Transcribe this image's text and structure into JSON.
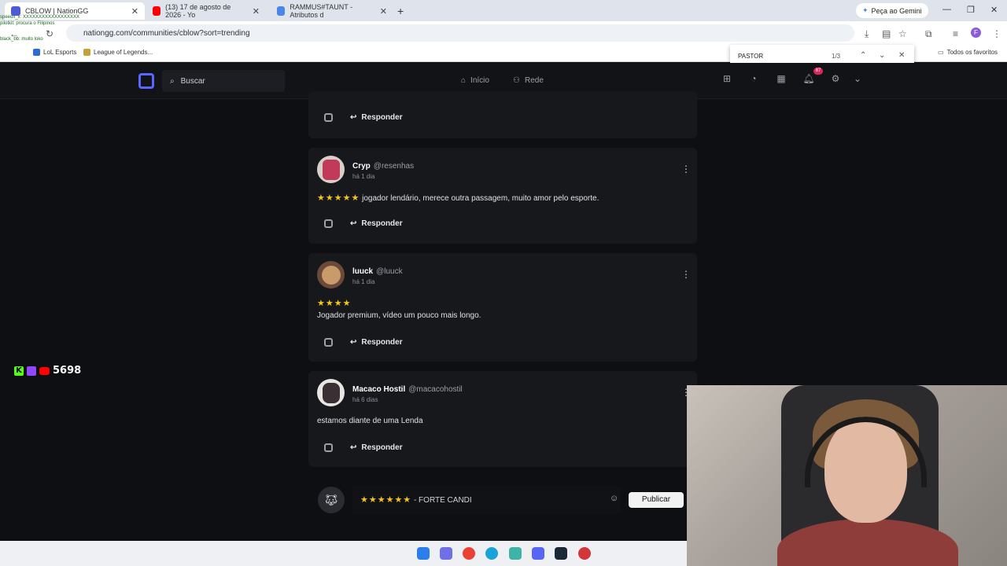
{
  "browser": {
    "tabs": [
      {
        "title": "CBLOW | NationGG",
        "active": true
      },
      {
        "title": "(13) 17 de agosto de 2026 - Yo",
        "active": false
      },
      {
        "title": "RAMMUS#TAUNT - Atributos d",
        "active": false
      }
    ],
    "new_tab": "+",
    "gemini": "Peça ao Gemini",
    "url": "nationgg.com/communities/cblow?sort=trending",
    "bookmarks": [
      "LoL Esports",
      "League of Legends..."
    ],
    "bookmarks_right": "Todos os favoritos",
    "find": {
      "query": "PASTOR",
      "count": "1/3"
    }
  },
  "overlay": {
    "chat_lines": [
      "speedx_x: XXXXXXXXXXXXXXXXXX",
      "pilotkit: procura o Filipinos",
      "black_bb: muito loko"
    ],
    "counter": "5698"
  },
  "app": {
    "search_placeholder": "Buscar",
    "nav": {
      "home": "Início",
      "network": "Rede"
    },
    "notif_count": "87"
  },
  "posts": [
    {
      "reply": "Responder"
    },
    {
      "name": "Cryp",
      "handle": "@resenhas",
      "time": "há 1 dia",
      "stars": "★★★★★",
      "text": "jogador lendário, merece outra passagem, muito amor pelo esporte.",
      "reply": "Responder"
    },
    {
      "name": "luuck",
      "handle": "@luuck",
      "time": "há 1 dia",
      "stars": "★★★★",
      "text": "Jogador premium, vídeo um pouco mais longo.",
      "reply": "Responder"
    },
    {
      "name": "Macaco Hostil",
      "handle": "@macacohostil",
      "time": "há 6 dias",
      "text": "estamos diante de uma Lenda",
      "reply": "Responder"
    }
  ],
  "composer": {
    "stars": "★★★★★★",
    "text": "- FORTE CANDI",
    "publish": "Publicar"
  }
}
